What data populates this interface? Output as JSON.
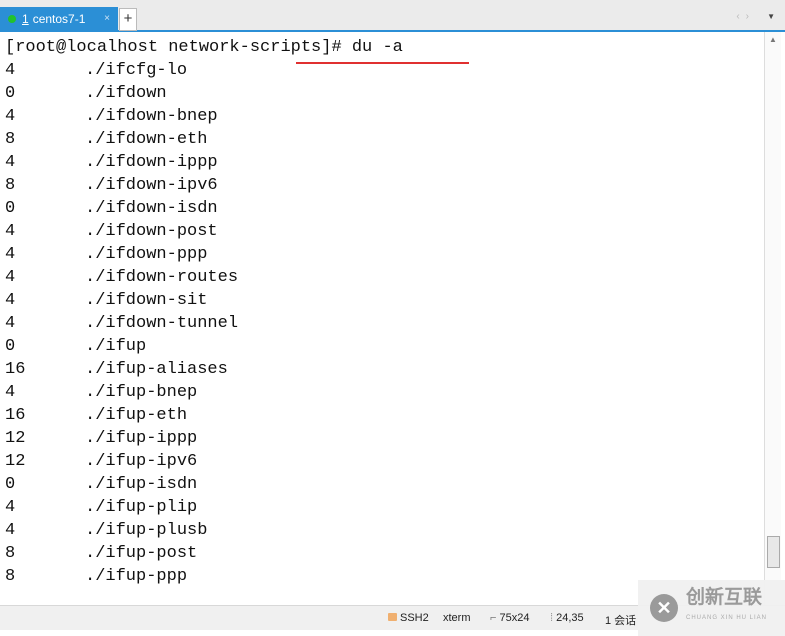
{
  "tabs": [
    {
      "number": "1",
      "label": "centos7-1",
      "status_color": "#22c22c"
    }
  ],
  "add_tab_label": "+",
  "close_tab_label": "×",
  "terminal": {
    "prompt": "[root@localhost network-scripts]# du -a",
    "rows": [
      {
        "size": "4",
        "path": "./ifcfg-lo"
      },
      {
        "size": "0",
        "path": "./ifdown"
      },
      {
        "size": "4",
        "path": "./ifdown-bnep"
      },
      {
        "size": "8",
        "path": "./ifdown-eth"
      },
      {
        "size": "4",
        "path": "./ifdown-ippp"
      },
      {
        "size": "8",
        "path": "./ifdown-ipv6"
      },
      {
        "size": "0",
        "path": "./ifdown-isdn"
      },
      {
        "size": "4",
        "path": "./ifdown-post"
      },
      {
        "size": "4",
        "path": "./ifdown-ppp"
      },
      {
        "size": "4",
        "path": "./ifdown-routes"
      },
      {
        "size": "4",
        "path": "./ifdown-sit"
      },
      {
        "size": "4",
        "path": "./ifdown-tunnel"
      },
      {
        "size": "0",
        "path": "./ifup"
      },
      {
        "size": "16",
        "path": "./ifup-aliases"
      },
      {
        "size": "4",
        "path": "./ifup-bnep"
      },
      {
        "size": "16",
        "path": "./ifup-eth"
      },
      {
        "size": "12",
        "path": "./ifup-ippp"
      },
      {
        "size": "12",
        "path": "./ifup-ipv6"
      },
      {
        "size": "0",
        "path": "./ifup-isdn"
      },
      {
        "size": "4",
        "path": "./ifup-plip"
      },
      {
        "size": "4",
        "path": "./ifup-plusb"
      },
      {
        "size": "8",
        "path": "./ifup-post"
      },
      {
        "size": "8",
        "path": "./ifup-ppp"
      }
    ],
    "highlight_color": "#e03030"
  },
  "status": {
    "protocol": "SSH2",
    "term_type": "xterm",
    "size": "75x24",
    "cursor": "24,35",
    "sessions": "1 会话"
  },
  "watermark": {
    "text": "创新互联",
    "sub": "CHUANG XIN HU LIAN"
  }
}
